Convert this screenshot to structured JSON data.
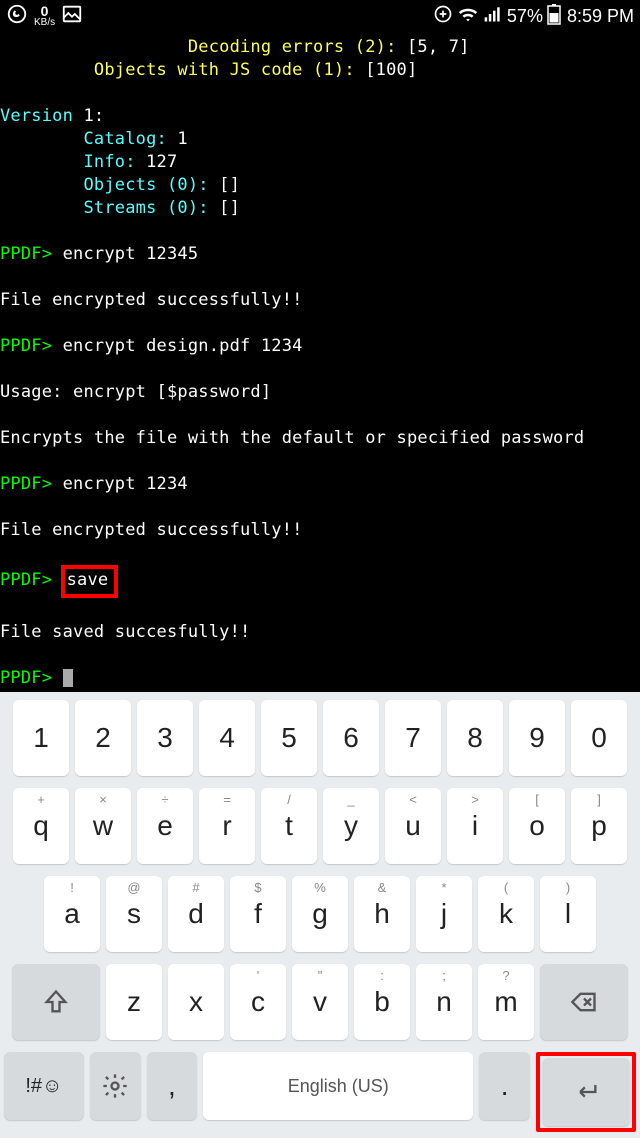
{
  "statusbar": {
    "kbps": "0",
    "kbps_unit": "KB/s",
    "battery": "57%",
    "time": "8:59 PM"
  },
  "terminal": {
    "l1a": "Decoding errors (2): ",
    "l1b": "[5, 7]",
    "l2a": "Objects with JS code (1): ",
    "l2b": "[100]",
    "l3": "Version ",
    "l3b": "1:",
    "l4": "Catalog: ",
    "l4b": "1",
    "l5": "Info: ",
    "l5b": "127",
    "l6": "Objects (0): ",
    "l6b": "[]",
    "l7": "Streams (0): ",
    "l7b": "[]",
    "p1": "PPDF> ",
    "c1": "encrypt 12345",
    "r1": "File encrypted successfully!!",
    "p2": "PPDF> ",
    "c2": "encrypt design.pdf 1234",
    "r2": "Usage: encrypt [$password]",
    "r3": "Encrypts the file with the default or specified password",
    "p3": "PPDF> ",
    "c3": "encrypt 1234",
    "r4": "File encrypted successfully!!",
    "p4": "PPDF> ",
    "c4": "save",
    "r5": "File saved succesfully!!",
    "p5": "PPDF> "
  },
  "keyboard": {
    "row1": [
      "1",
      "2",
      "3",
      "4",
      "5",
      "6",
      "7",
      "8",
      "9",
      "0"
    ],
    "row2_sup": [
      "+",
      "×",
      "÷",
      "=",
      "/",
      "_",
      "<",
      ">",
      "[",
      "]"
    ],
    "row2": [
      "q",
      "w",
      "e",
      "r",
      "t",
      "y",
      "u",
      "i",
      "o",
      "p"
    ],
    "row3_sup": [
      "!",
      "@",
      "#",
      "$",
      "%",
      "&",
      "*",
      "(",
      ")"
    ],
    "row3": [
      "a",
      "s",
      "d",
      "f",
      "g",
      "h",
      "j",
      "k",
      "l"
    ],
    "row4_sup": [
      "",
      "",
      "'",
      "\"",
      ":",
      ";",
      "?"
    ],
    "row4": [
      "z",
      "x",
      "c",
      "v",
      "b",
      "n",
      "m"
    ],
    "sym": "!#☺",
    "comma": ",",
    "space": "English (US)",
    "period": "."
  }
}
